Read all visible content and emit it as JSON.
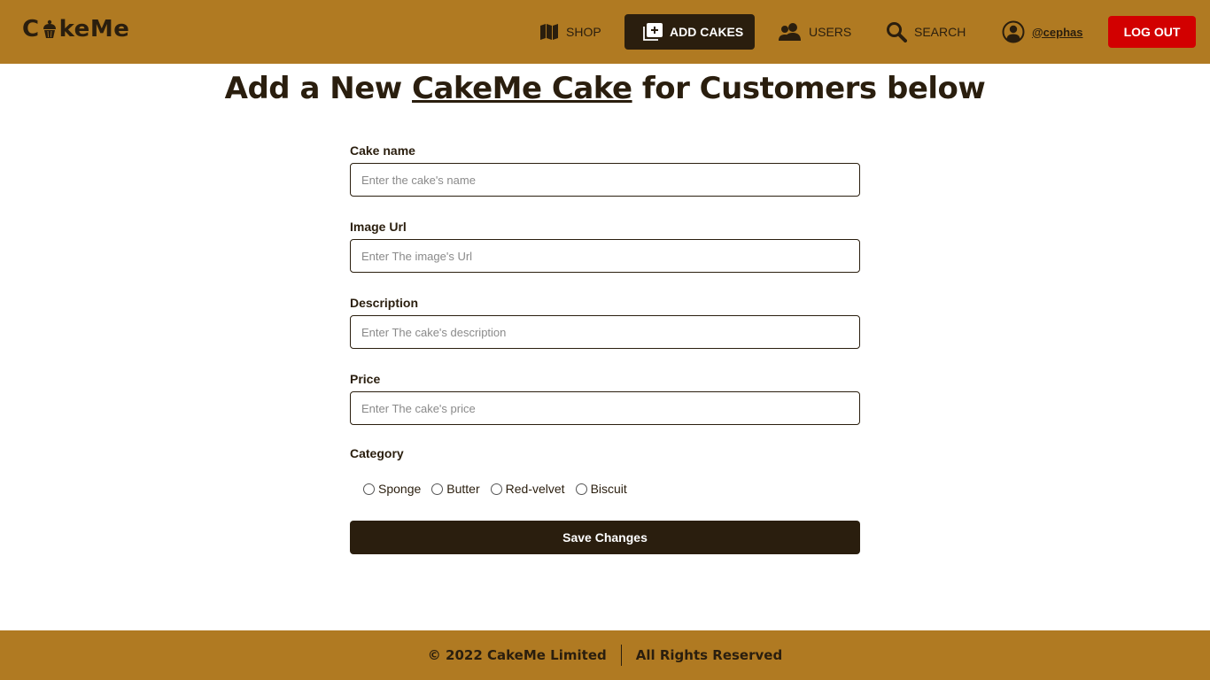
{
  "brand": {
    "name_prefix": "C",
    "name_suffix": "keMe"
  },
  "nav": {
    "shop": {
      "label": "SHOP",
      "icon": "map-icon"
    },
    "add_cakes": {
      "label": "ADD CAKES",
      "icon": "add-box-icon"
    },
    "users": {
      "label": "USERS",
      "icon": "users-icon"
    },
    "search": {
      "label": "SEARCH",
      "icon": "search-icon"
    },
    "user": {
      "label": "@cephas",
      "icon": "user-circle-icon"
    },
    "logout": {
      "label": "LOG OUT"
    }
  },
  "page": {
    "title_before": "Add a New ",
    "title_em": "CakeMe Cake",
    "title_after": " for Customers below"
  },
  "form": {
    "cake_name": {
      "label": "Cake name",
      "placeholder": "Enter the cake's name",
      "value": ""
    },
    "image_url": {
      "label": "Image Url",
      "placeholder": "Enter The image's Url",
      "value": ""
    },
    "description": {
      "label": "Description",
      "placeholder": "Enter The cake's description",
      "value": ""
    },
    "price": {
      "label": "Price",
      "placeholder": "Enter The cake's price",
      "value": ""
    },
    "category": {
      "label": "Category",
      "options": [
        "Sponge",
        "Butter",
        "Red-velvet",
        "Biscuit"
      ]
    },
    "save_label": "Save Changes"
  },
  "footer": {
    "copyright": "© 2022 CakeMe Limited",
    "rights": "All Rights Reserved"
  },
  "colors": {
    "header_bg": "#b07a22",
    "dark": "#2a1e0e",
    "logout_bg": "#d20000"
  }
}
